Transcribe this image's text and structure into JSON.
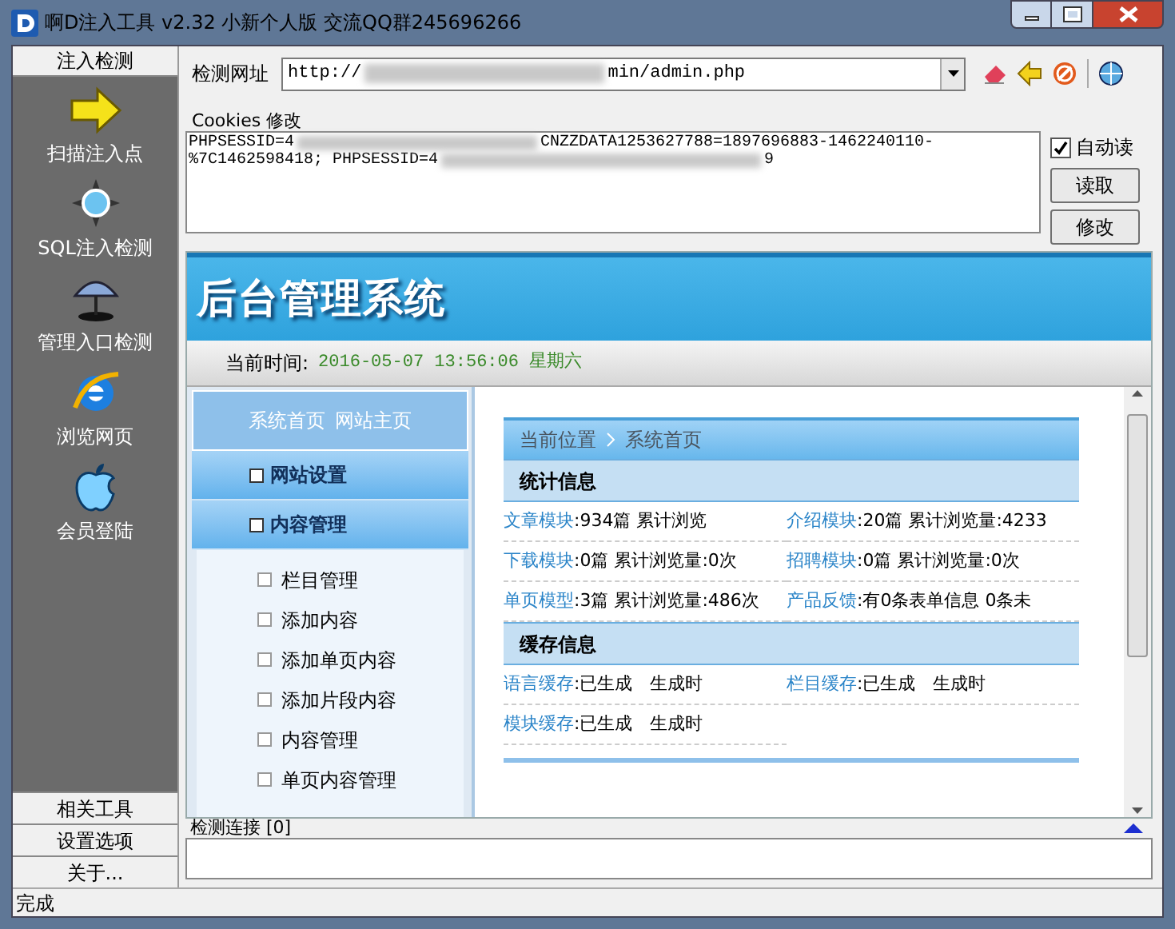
{
  "window": {
    "title": "啊D注入工具 v2.32 小新个人版 交流QQ群245696266"
  },
  "sidebar": {
    "header": "注入检测",
    "items": [
      {
        "label": "扫描注入点"
      },
      {
        "label": "SQL注入检测"
      },
      {
        "label": "管理入口检测"
      },
      {
        "label": "浏览网页"
      },
      {
        "label": "会员登陆"
      }
    ],
    "footer_buttons": [
      "相关工具",
      "设置选项",
      "关于..."
    ]
  },
  "url_bar": {
    "label": "检测网址",
    "value_start": "http://",
    "value_end": "min/admin.php"
  },
  "cookies": {
    "label": "Cookies 修改",
    "lines": [
      {
        "start": "PHPSESSID=4",
        "end": "CNZZDATA1253627788=1897696883-1462240110-"
      },
      {
        "start": "%7C1462598418; PHPSESSID=4",
        "end": "9"
      }
    ],
    "auto_read": {
      "label": "自动读",
      "checked": true
    },
    "buttons": [
      "读取",
      "修改"
    ]
  },
  "page": {
    "banner": "后台管理系统",
    "time_label": "当前时间:",
    "time_value": "2016-05-07 13:56:06 星期六",
    "nav_links": [
      "系统首页",
      "网站主页"
    ],
    "nav_sections": [
      {
        "label": "网站设置"
      },
      {
        "label": "内容管理"
      }
    ],
    "nav_items": [
      "栏目管理",
      "添加内容",
      "添加单页内容",
      "添加片段内容",
      "内容管理",
      "单页内容管理"
    ],
    "breadcrumb": {
      "label": "当前位置",
      "current": "系统首页"
    },
    "stats": {
      "title": "统计信息",
      "rows": [
        [
          {
            "key": "文章模块",
            "value": ":934篇 累计浏览"
          },
          {
            "key": "介绍模块",
            "value": ":20篇 累计浏览量:4233"
          }
        ],
        [
          {
            "key": "下载模块",
            "value": ":0篇 累计浏览量:0次"
          },
          {
            "key": "招聘模块",
            "value": ":0篇 累计浏览量:0次"
          }
        ],
        [
          {
            "key": "单页模型",
            "value": ":3篇 累计浏览量:486次"
          },
          {
            "key": "产品反馈",
            "value": ":有0条表单信息 0条未"
          }
        ]
      ]
    },
    "cache": {
      "title": "缓存信息",
      "rows": [
        [
          {
            "key": "语言缓存",
            "value": ":已生成　生成时"
          },
          {
            "key": "栏目缓存",
            "value": ":已生成　生成时"
          }
        ],
        [
          {
            "key": "模块缓存",
            "value": ":已生成　生成时"
          }
        ]
      ]
    }
  },
  "log": {
    "label": "检测连接 [0]"
  },
  "status_bar": {
    "text": "完成"
  }
}
